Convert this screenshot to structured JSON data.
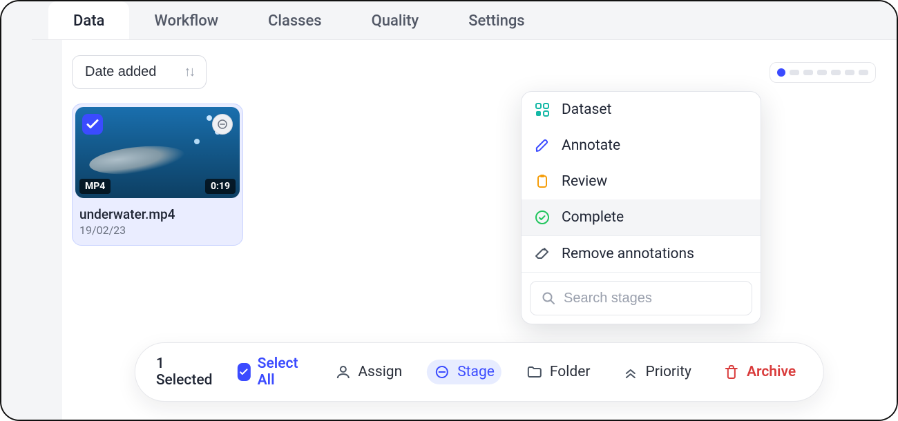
{
  "tabs": [
    "Data",
    "Workflow",
    "Classes",
    "Quality",
    "Settings"
  ],
  "active_tab_index": 0,
  "sort": {
    "label": "Date added"
  },
  "card": {
    "format": "MP4",
    "duration": "0:19",
    "filename": "underwater.mp4",
    "date": "19/02/23",
    "selected": true
  },
  "stage_popover": {
    "items": [
      {
        "label": "Dataset"
      },
      {
        "label": "Annotate"
      },
      {
        "label": "Review"
      },
      {
        "label": "Complete",
        "hovered": true
      },
      {
        "label": "Remove annotations"
      }
    ],
    "search_placeholder": "Search stages"
  },
  "action_bar": {
    "selected_text": "1 Selected",
    "select_all": "Select All",
    "assign": "Assign",
    "stage": "Stage",
    "folder": "Folder",
    "priority": "Priority",
    "archive": "Archive"
  }
}
